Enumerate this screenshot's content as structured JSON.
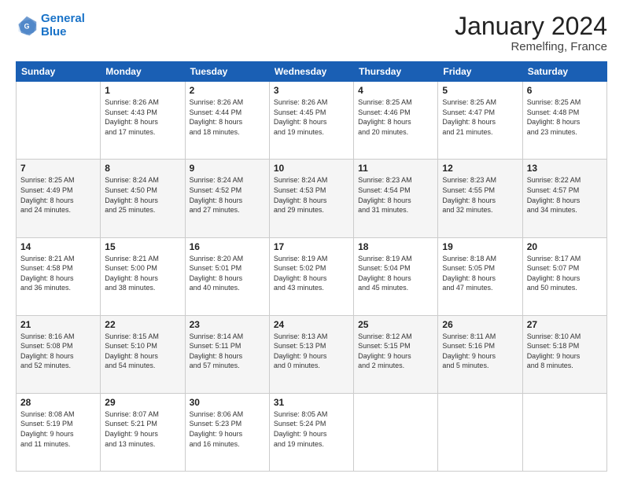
{
  "logo": {
    "line1": "General",
    "line2": "Blue"
  },
  "title": "January 2024",
  "subtitle": "Remelfing, France",
  "header": {
    "days": [
      "Sunday",
      "Monday",
      "Tuesday",
      "Wednesday",
      "Thursday",
      "Friday",
      "Saturday"
    ]
  },
  "weeks": [
    [
      {
        "day": "",
        "info": ""
      },
      {
        "day": "1",
        "info": "Sunrise: 8:26 AM\nSunset: 4:43 PM\nDaylight: 8 hours\nand 17 minutes."
      },
      {
        "day": "2",
        "info": "Sunrise: 8:26 AM\nSunset: 4:44 PM\nDaylight: 8 hours\nand 18 minutes."
      },
      {
        "day": "3",
        "info": "Sunrise: 8:26 AM\nSunset: 4:45 PM\nDaylight: 8 hours\nand 19 minutes."
      },
      {
        "day": "4",
        "info": "Sunrise: 8:25 AM\nSunset: 4:46 PM\nDaylight: 8 hours\nand 20 minutes."
      },
      {
        "day": "5",
        "info": "Sunrise: 8:25 AM\nSunset: 4:47 PM\nDaylight: 8 hours\nand 21 minutes."
      },
      {
        "day": "6",
        "info": "Sunrise: 8:25 AM\nSunset: 4:48 PM\nDaylight: 8 hours\nand 23 minutes."
      }
    ],
    [
      {
        "day": "7",
        "info": ""
      },
      {
        "day": "8",
        "info": "Sunrise: 8:24 AM\nSunset: 4:50 PM\nDaylight: 8 hours\nand 25 minutes."
      },
      {
        "day": "9",
        "info": "Sunrise: 8:24 AM\nSunset: 4:52 PM\nDaylight: 8 hours\nand 27 minutes."
      },
      {
        "day": "10",
        "info": "Sunrise: 8:24 AM\nSunset: 4:53 PM\nDaylight: 8 hours\nand 29 minutes."
      },
      {
        "day": "11",
        "info": "Sunrise: 8:23 AM\nSunset: 4:54 PM\nDaylight: 8 hours\nand 31 minutes."
      },
      {
        "day": "12",
        "info": "Sunrise: 8:23 AM\nSunset: 4:55 PM\nDaylight: 8 hours\nand 32 minutes."
      },
      {
        "day": "13",
        "info": "Sunrise: 8:22 AM\nSunset: 4:57 PM\nDaylight: 8 hours\nand 34 minutes."
      }
    ],
    [
      {
        "day": "14",
        "info": "Sunrise: 8:21 AM\nSunset: 4:58 PM\nDaylight: 8 hours\nand 36 minutes."
      },
      {
        "day": "15",
        "info": "Sunrise: 8:21 AM\nSunset: 5:00 PM\nDaylight: 8 hours\nand 38 minutes."
      },
      {
        "day": "16",
        "info": "Sunrise: 8:20 AM\nSunset: 5:01 PM\nDaylight: 8 hours\nand 40 minutes."
      },
      {
        "day": "17",
        "info": "Sunrise: 8:19 AM\nSunset: 5:02 PM\nDaylight: 8 hours\nand 43 minutes."
      },
      {
        "day": "18",
        "info": "Sunrise: 8:19 AM\nSunset: 5:04 PM\nDaylight: 8 hours\nand 45 minutes."
      },
      {
        "day": "19",
        "info": "Sunrise: 8:18 AM\nSunset: 5:05 PM\nDaylight: 8 hours\nand 47 minutes."
      },
      {
        "day": "20",
        "info": "Sunrise: 8:17 AM\nSunset: 5:07 PM\nDaylight: 8 hours\nand 50 minutes."
      }
    ],
    [
      {
        "day": "21",
        "info": "Sunrise: 8:16 AM\nSunset: 5:08 PM\nDaylight: 8 hours\nand 52 minutes."
      },
      {
        "day": "22",
        "info": "Sunrise: 8:15 AM\nSunset: 5:10 PM\nDaylight: 8 hours\nand 54 minutes."
      },
      {
        "day": "23",
        "info": "Sunrise: 8:14 AM\nSunset: 5:11 PM\nDaylight: 8 hours\nand 57 minutes."
      },
      {
        "day": "24",
        "info": "Sunrise: 8:13 AM\nSunset: 5:13 PM\nDaylight: 9 hours\nand 0 minutes."
      },
      {
        "day": "25",
        "info": "Sunrise: 8:12 AM\nSunset: 5:15 PM\nDaylight: 9 hours\nand 2 minutes."
      },
      {
        "day": "26",
        "info": "Sunrise: 8:11 AM\nSunset: 5:16 PM\nDaylight: 9 hours\nand 5 minutes."
      },
      {
        "day": "27",
        "info": "Sunrise: 8:10 AM\nSunset: 5:18 PM\nDaylight: 9 hours\nand 8 minutes."
      }
    ],
    [
      {
        "day": "28",
        "info": "Sunrise: 8:08 AM\nSunset: 5:19 PM\nDaylight: 9 hours\nand 11 minutes."
      },
      {
        "day": "29",
        "info": "Sunrise: 8:07 AM\nSunset: 5:21 PM\nDaylight: 9 hours\nand 13 minutes."
      },
      {
        "day": "30",
        "info": "Sunrise: 8:06 AM\nSunset: 5:23 PM\nDaylight: 9 hours\nand 16 minutes."
      },
      {
        "day": "31",
        "info": "Sunrise: 8:05 AM\nSunset: 5:24 PM\nDaylight: 9 hours\nand 19 minutes."
      },
      {
        "day": "",
        "info": ""
      },
      {
        "day": "",
        "info": ""
      },
      {
        "day": "",
        "info": ""
      }
    ]
  ],
  "week7_day7_info": "Sunrise: 8:25 AM\nSunset: 4:49 PM\nDaylight: 8 hours\nand 24 minutes."
}
